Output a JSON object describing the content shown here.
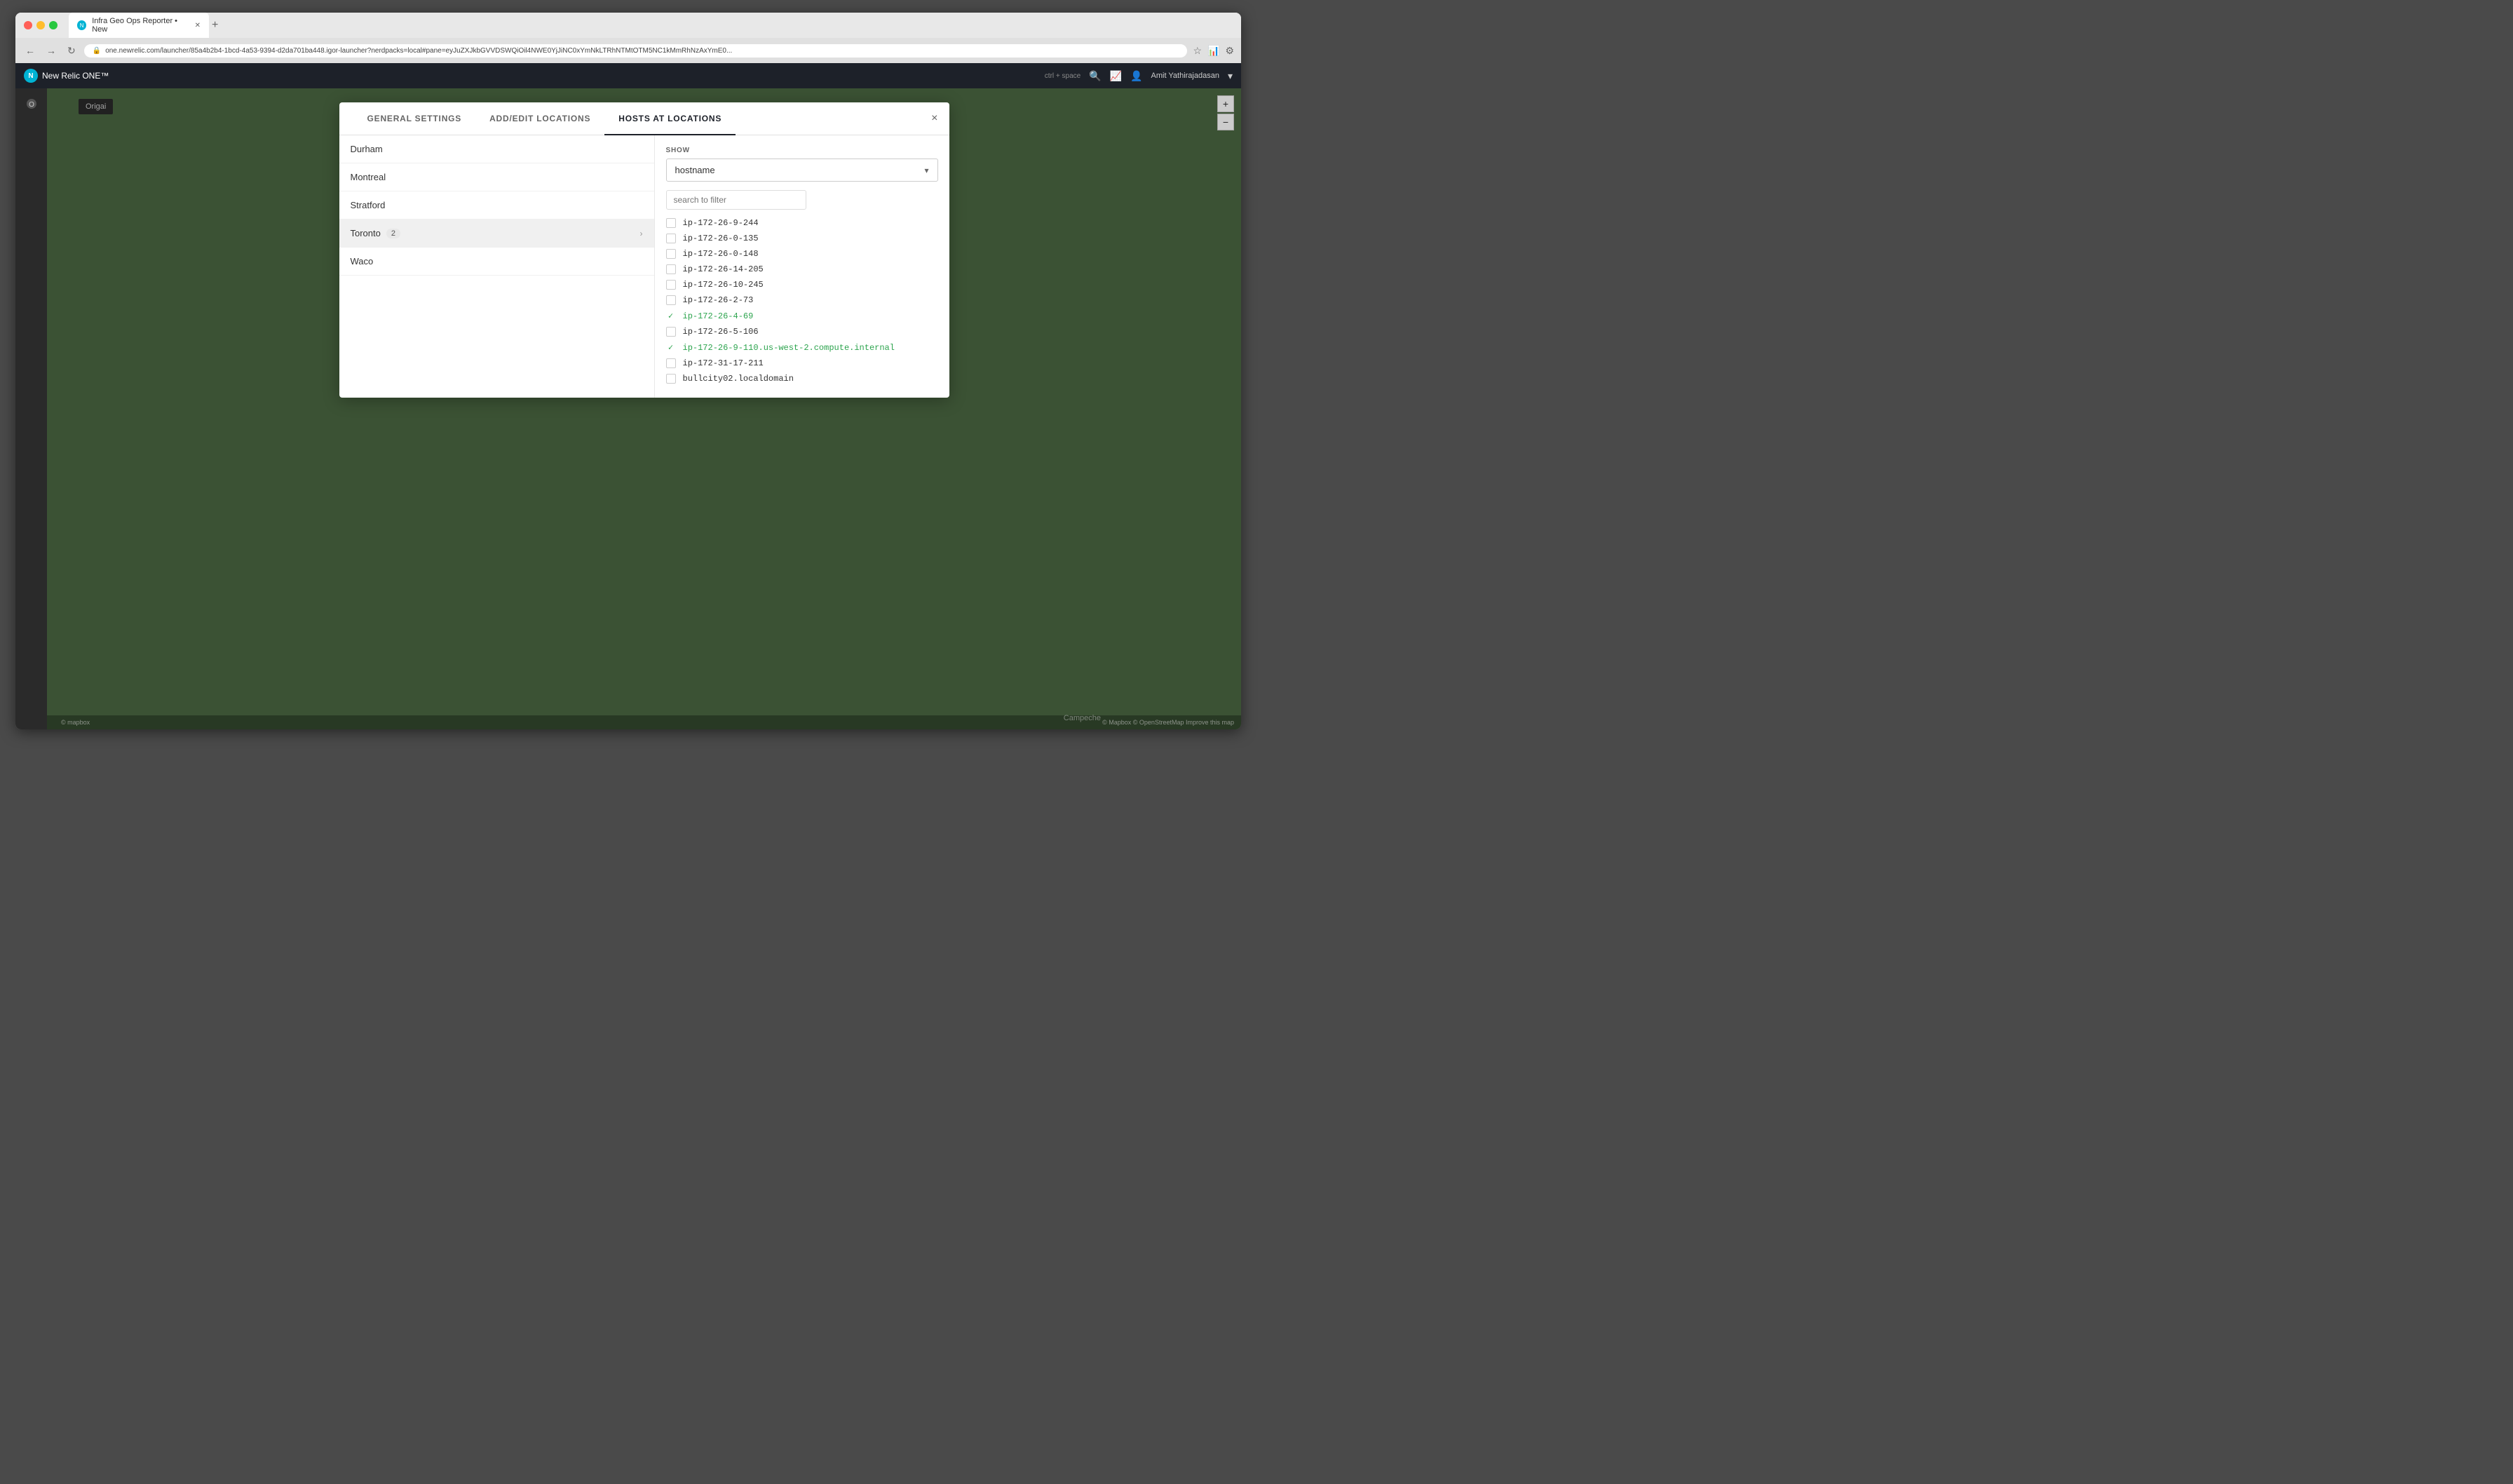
{
  "browser": {
    "tab_title": "Infra Geo Ops Reporter • New",
    "url": "one.newrelic.com/launcher/85a4b2b4-1bcd-4a53-9394-d2da701ba448.igor-launcher?nerdpacks=local#pane=eyJuZXJkbGVVDSWQiOil4NWE0YjJiNC0xYmNkLTRhNTMtOTM5NC1kMmRhNzAxYmE0...",
    "nav": {
      "back": "←",
      "forward": "→",
      "reload": "↻"
    }
  },
  "newrelic": {
    "logo_text": "New Relic ONE™",
    "shortcut": "ctrl + space",
    "user": "Amit Yathirajadasan"
  },
  "modal": {
    "tabs": [
      {
        "label": "GENERAL SETTINGS",
        "active": false
      },
      {
        "label": "ADD/EDIT LOCATIONS",
        "active": false
      },
      {
        "label": "HOSTS AT LOCATIONS",
        "active": true
      }
    ],
    "close_button": "×",
    "locations": [
      {
        "name": "Durham",
        "count": null,
        "active": false
      },
      {
        "name": "Montreal",
        "count": null,
        "active": false
      },
      {
        "name": "Stratford",
        "count": null,
        "active": false
      },
      {
        "name": "Toronto",
        "count": 2,
        "active": true
      },
      {
        "name": "Waco",
        "count": null,
        "active": false
      }
    ],
    "show_label": "SHOW",
    "dropdown_value": "hostname",
    "search_placeholder": "search to filter",
    "hosts": [
      {
        "name": "ip-172-26-9-244",
        "selected": false,
        "checked": false
      },
      {
        "name": "ip-172-26-0-135",
        "selected": false,
        "checked": false
      },
      {
        "name": "ip-172-26-0-148",
        "selected": false,
        "checked": false
      },
      {
        "name": "ip-172-26-14-205",
        "selected": false,
        "checked": false
      },
      {
        "name": "ip-172-26-10-245",
        "selected": false,
        "checked": false
      },
      {
        "name": "ip-172-26-2-73",
        "selected": false,
        "checked": false
      },
      {
        "name": "ip-172-26-4-69",
        "selected": true,
        "checked": true
      },
      {
        "name": "ip-172-26-5-106",
        "selected": false,
        "checked": false
      },
      {
        "name": "ip-172-26-9-110.us-west-2.compute.internal",
        "selected": true,
        "checked": true
      },
      {
        "name": "ip-172-31-17-211",
        "selected": false,
        "checked": false
      },
      {
        "name": "bullcity02.localdomain",
        "selected": false,
        "checked": false
      }
    ]
  },
  "map": {
    "footer_text": "© Mapbox © OpenStreetMap  Improve this map",
    "logo": "© mapbox",
    "map_label": "Campeche"
  },
  "sidebar": {
    "origami_label": "Origai",
    "plus_icon": "+",
    "minus_icon": "−"
  }
}
